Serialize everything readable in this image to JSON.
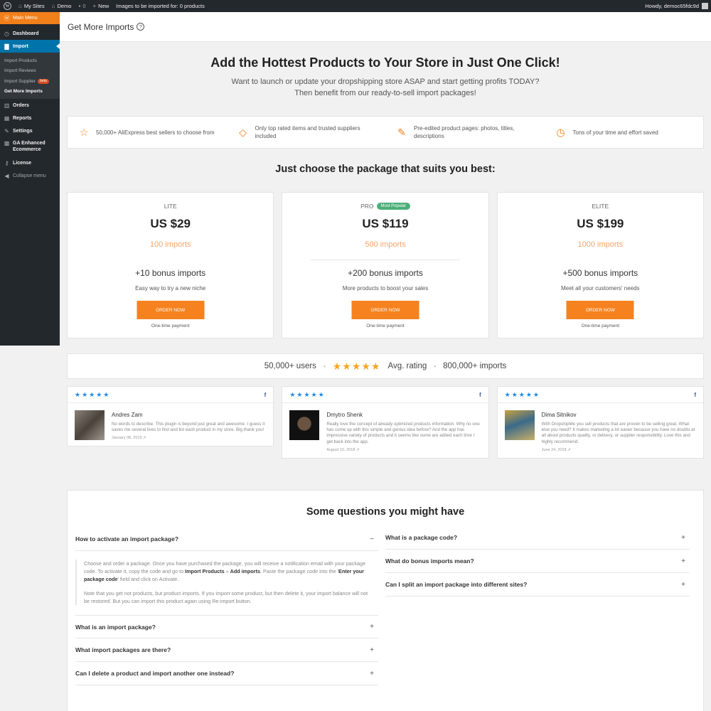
{
  "adminbar": {
    "my_sites": "My Sites",
    "site": "Demo",
    "comments": "0",
    "new": "New",
    "notice": "Images to be imported for: 0 products",
    "howdy": "Howdy, democ65fdc9d"
  },
  "sidebar": {
    "main_menu": "Main Menu",
    "dashboard": "Dashboard",
    "import": "Import",
    "submenu": [
      "Import Products",
      "Import Reviews",
      "Import Supplier",
      "Get More Imports"
    ],
    "beta": "beta",
    "orders": "Orders",
    "reports": "Reports",
    "settings": "Settings",
    "ga": "GA Enhanced Ecommerce",
    "license": "License",
    "collapse": "Collapse menu"
  },
  "header": {
    "title": "Get More Imports",
    "help": "?"
  },
  "hero": {
    "title": "Add the Hottest Products to Your Store in Just One Click!",
    "line1": "Want to launch or update your dropshipping store ASAP and start getting profits TODAY?",
    "line2": "Then benefit from our ready-to-sell import packages!"
  },
  "features": [
    "50,000+ AliExpress best sellers to choose from",
    "Only top rated items and trusted suppliers included",
    "Pre-edited product pages: photos, titles, descriptions",
    "Tons of your time and effort saved"
  ],
  "choose_title": "Just choose the package that suits you best:",
  "packages": [
    {
      "name": "LITE",
      "price": "US $29",
      "imports": "100 imports",
      "bonus": "+10 bonus imports",
      "desc": "Easy way to try a new niche",
      "button": "ORDER NOW",
      "note": "One-time payment"
    },
    {
      "name": "PRO",
      "badge": "Most Popular",
      "price": "US $119",
      "imports": "500 imports",
      "bonus": "+200 bonus imports",
      "desc": "More products to boost your sales",
      "button": "ORDER NOW",
      "note": "One-time payment"
    },
    {
      "name": "ELITE",
      "price": "US $199",
      "imports": "1000 imports",
      "bonus": "+500 bonus imports",
      "desc": "Meet all your customers' needs",
      "button": "ORDER NOW",
      "note": "One-time payment"
    }
  ],
  "stats": {
    "users": "50,000+ users",
    "stars": "★★★★★",
    "rating": "Avg. rating",
    "imports": "800,000+ imports"
  },
  "reviews": [
    {
      "name": "Andres Zam",
      "text": "No words to describe. This plugin is beyond just great and awesome. I guess it saves me several lives to find and list each product in my store. Big thank you!",
      "date": "January 08, 2019"
    },
    {
      "name": "Dmytro Shenk",
      "text": "Really love the concept of already optimized products information. Why no one has come up with this simple and genius idea before? And the app has impressive variety of products and it seems like some are added each time I get back into the app.",
      "date": "August 10, 2018"
    },
    {
      "name": "Dima Sitnikov",
      "text": "With DropshipMe you sell products that are proven to be selling great. What else you need? It makes marketing a lot easier because you have no doubts at all about products quality, or delivery, or supplier responsibility. Love this and highly recommend.",
      "date": "June 24, 2018"
    }
  ],
  "review_stars": "★★★★★",
  "faq": {
    "title": "Some questions you might have",
    "left": [
      "How to activate an import package?",
      "What is an import package?",
      "What import packages are there?",
      "Can I delete a product and import another one instead?"
    ],
    "right": [
      "What is a package code?",
      "What do bonus imports mean?",
      "Can I split an import package into different sites?"
    ],
    "answer": {
      "p1a": "Choose and order a package. Once you have purchased the package, you will receive a notification email with your package code. To activate it, copy the code and go to ",
      "p1b": "Import Products",
      "p1c": " » ",
      "p1d": "Add imports",
      "p1e": ". Paste the package code into the '",
      "p1f": "Enter your package code",
      "p1g": "' field and click on Activate.",
      "p2": "Note that you get not products, but product imports. If you import some product, but then delete it, your import balance will not be restored. But you can import this product again using Re-import button."
    }
  },
  "colors": {
    "accent": "#f5821f",
    "admin_blue": "#0073aa",
    "popular": "#4caf78",
    "star_blue": "#1e88e5",
    "star_gold": "#f5a623"
  }
}
